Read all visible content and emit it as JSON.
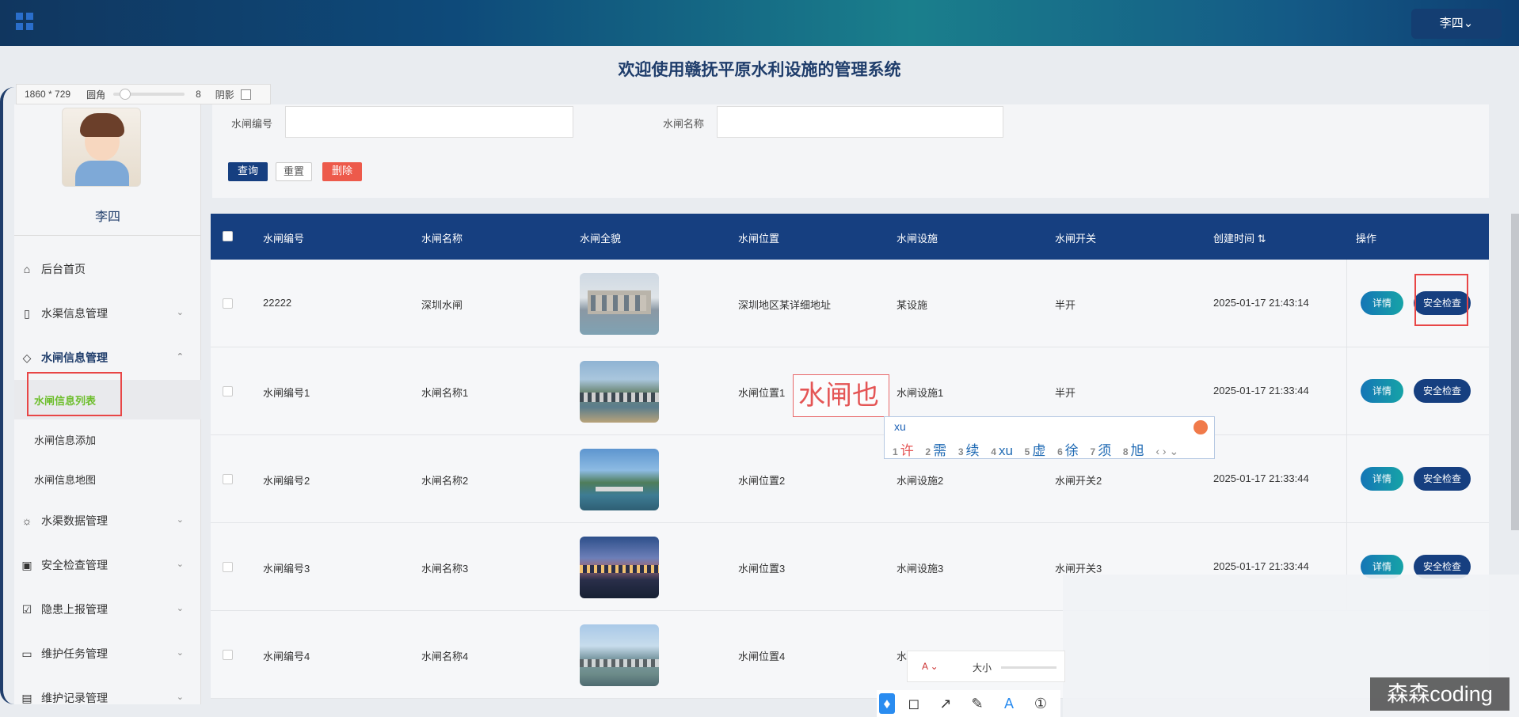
{
  "header": {
    "user_label": "李四⌄"
  },
  "page_title": "欢迎使用赣抚平原水利设施的管理系统",
  "screenshot_toolbar": {
    "size": "1860 * 729",
    "corner_label": "圆角",
    "corner_value": "8",
    "shadow_label": "阴影"
  },
  "sidebar": {
    "username": "李四",
    "items": [
      {
        "label": "后台首页",
        "icon": "home-icon"
      },
      {
        "label": "水渠信息管理",
        "icon": "bookmark-icon"
      },
      {
        "label": "水闸信息管理",
        "icon": "tag-icon"
      },
      {
        "label": "水渠数据管理",
        "icon": "sun-icon"
      },
      {
        "label": "安全检查管理",
        "icon": "inbox-icon"
      },
      {
        "label": "隐患上报管理",
        "icon": "clipboard-icon"
      },
      {
        "label": "维护任务管理",
        "icon": "chat-icon"
      },
      {
        "label": "维护记录管理",
        "icon": "document-icon"
      }
    ],
    "subitems": [
      "水闸信息列表",
      "水闸信息添加",
      "水闸信息地图"
    ]
  },
  "search": {
    "field1_label": "水闸编号",
    "field2_label": "水闸名称",
    "query_btn": "查询",
    "reset_btn": "重置",
    "delete_btn": "删除"
  },
  "table": {
    "columns": [
      "水闸编号",
      "水闸名称",
      "水闸全貌",
      "水闸位置",
      "水闸设施",
      "水闸开关",
      "创建时间 ⇅",
      "操作"
    ],
    "rows": [
      {
        "code": "22222",
        "name": "深圳水闸",
        "location": "深圳地区某详细地址",
        "facility": "某设施",
        "switch": "半开",
        "time": "2025-01-17 21:43:14"
      },
      {
        "code": "水闸编号1",
        "name": "水闸名称1",
        "location": "水闸位置1",
        "facility": "水闸设施1",
        "switch": "半开",
        "time": "2025-01-17 21:33:44"
      },
      {
        "code": "水闸编号2",
        "name": "水闸名称2",
        "location": "水闸位置2",
        "facility": "水闸设施2",
        "switch": "水闸开关2",
        "time": "2025-01-17 21:33:44"
      },
      {
        "code": "水闸编号3",
        "name": "水闸名称3",
        "location": "水闸位置3",
        "facility": "水闸设施3",
        "switch": "水闸开关3",
        "time": "2025-01-17 21:33:44"
      },
      {
        "code": "水闸编号4",
        "name": "水闸名称4",
        "location": "水闸位置4",
        "facility": "水",
        "switch": "",
        "time": ""
      }
    ],
    "detail_btn": "详情",
    "safety_btn": "安全检查"
  },
  "ime": {
    "composing_text": "水闸也",
    "pinyin": "xu",
    "candidates": [
      {
        "n": "1",
        "c": "许"
      },
      {
        "n": "2",
        "c": "需"
      },
      {
        "n": "3",
        "c": "续"
      },
      {
        "n": "4",
        "c": "xu"
      },
      {
        "n": "5",
        "c": "虚"
      },
      {
        "n": "6",
        "c": "徐"
      },
      {
        "n": "7",
        "c": "须"
      },
      {
        "n": "8",
        "c": "旭"
      }
    ],
    "nav": "‹ › ⌄"
  },
  "draw_toolbar": {
    "font_color_label": "A ⌄",
    "size_label": "大小"
  },
  "watermark": "森森coding"
}
